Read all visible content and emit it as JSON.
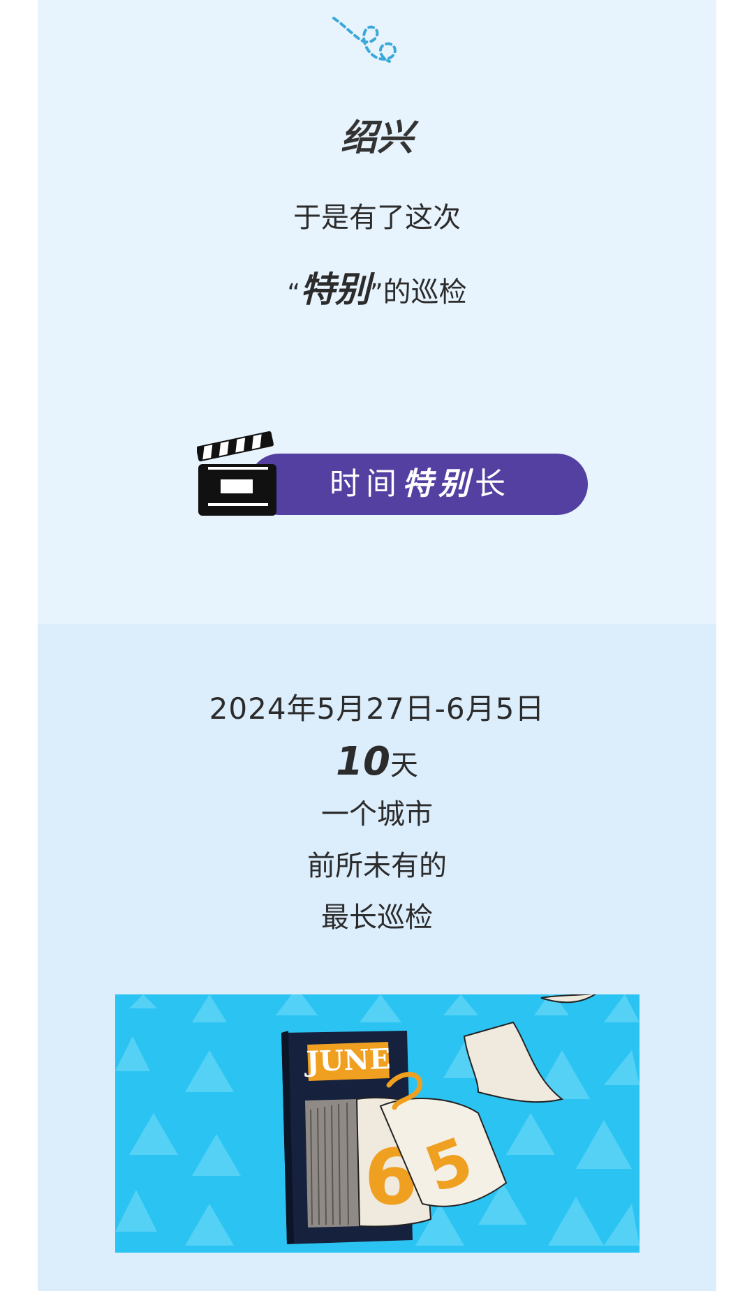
{
  "intro": {
    "city": "绍兴",
    "line1": "于是有了这次",
    "quote_open": "“",
    "quote_strong": "特别",
    "quote_close": "”",
    "quote_rest": "的巡检"
  },
  "tag": {
    "prefix": "时间",
    "emphasis": "特别",
    "suffix": "长"
  },
  "details": {
    "date_range": "2024年5月27日-6月5日",
    "days_number": "10",
    "days_unit": "天",
    "line_city": "一个城市",
    "line_unprecedented": "前所未有的",
    "line_longest": "最长巡检"
  },
  "illustration": {
    "calendar_month": "JUNE",
    "page_digit_front": "6",
    "page_digit_back": "5"
  },
  "colors": {
    "top_background": "#e7f3fd",
    "bottom_background": "#dcedfc",
    "pill": "#5440a0",
    "illustration_background": "#2bc4f2",
    "calendar_orange": "#f0a020"
  },
  "icons": {
    "doodle": "dashed-loop-doodle-icon",
    "clapperboard": "clapperboard-icon"
  }
}
